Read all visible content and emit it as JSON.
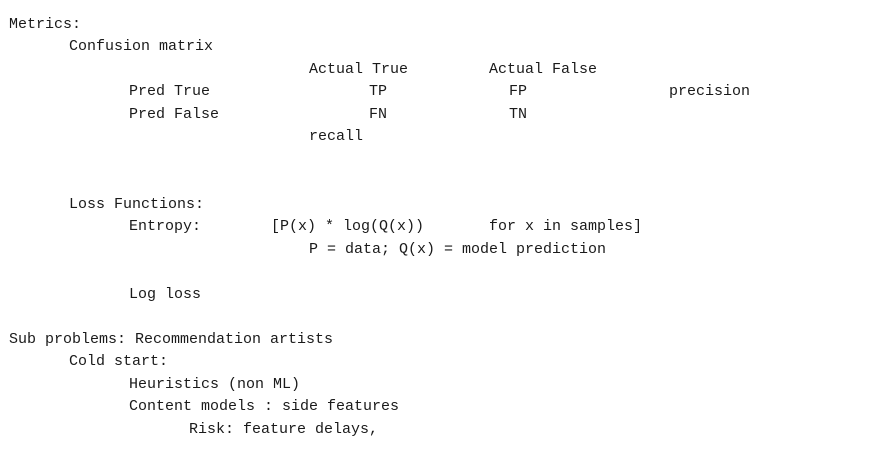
{
  "notes": {
    "metrics": {
      "heading": "Metrics:",
      "confusion_matrix": {
        "title": "Confusion matrix",
        "col_actual_true": "Actual True",
        "col_actual_false": "Actual False",
        "row_pred_true": "Pred True",
        "row_pred_false": "Pred False",
        "cell_tp": "TP",
        "cell_fp": "FP",
        "cell_fn": "FN",
        "cell_tn": "TN",
        "precision": "precision",
        "recall": "recall"
      },
      "loss_functions": {
        "title": "Loss Functions:",
        "entropy_label": "Entropy:",
        "entropy_formula": "[P(x) * log(Q(x))",
        "entropy_for": "for x in samples]",
        "entropy_def": "P = data; Q(x) = model prediction",
        "log_loss": "Log loss"
      }
    },
    "sub_problems": {
      "heading": "Sub problems: Recommendation artists",
      "cold_start": "Cold start:",
      "heuristics": "Heuristics (non ML)",
      "content_models": "Content models : side features",
      "risk": "Risk: feature delays,"
    }
  }
}
